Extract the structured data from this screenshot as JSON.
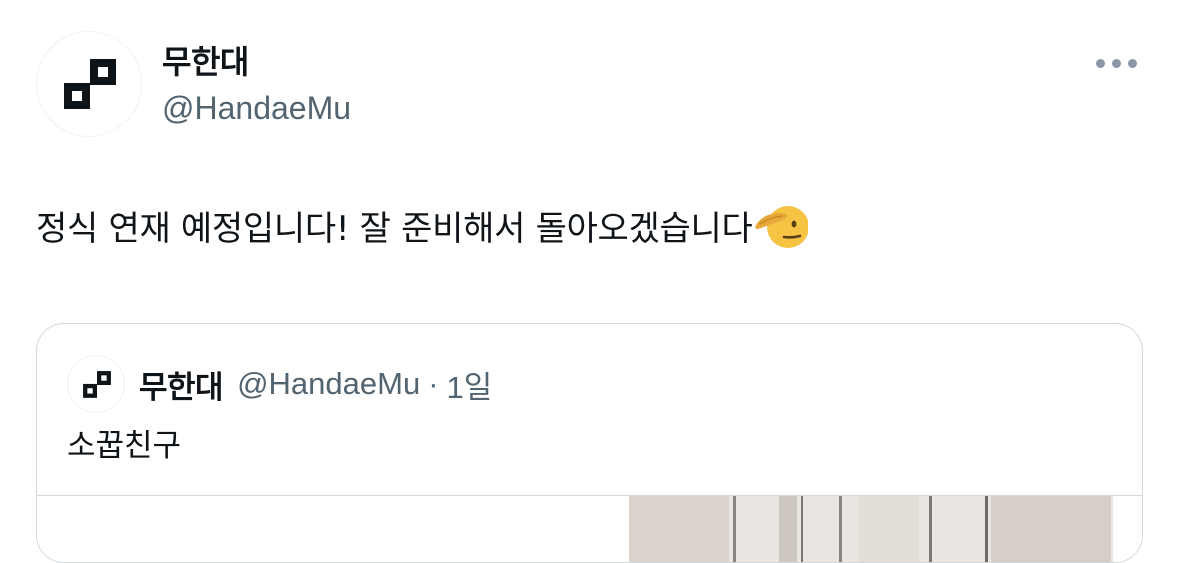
{
  "author": {
    "display_name": "무한대",
    "handle": "@HandaeMu",
    "avatar_icon": "pixel-logo-icon"
  },
  "menu": {
    "more_icon": "more-horizontal-icon"
  },
  "tweet": {
    "text": "정식 연재 예정입니다! 잘 준비해서 돌아오겠습니다",
    "emoji_icon": "saluting-face-emoji"
  },
  "quote": {
    "display_name": "무한대",
    "handle": "@HandaeMu",
    "separator": "·",
    "time": "1일",
    "text": "소꿉친구",
    "media_icon": "comic-panel-image"
  },
  "colors": {
    "text_primary": "#0f1419",
    "text_secondary": "#536471",
    "border": "#cfd9de",
    "emoji_yellow": "#f6c342"
  }
}
